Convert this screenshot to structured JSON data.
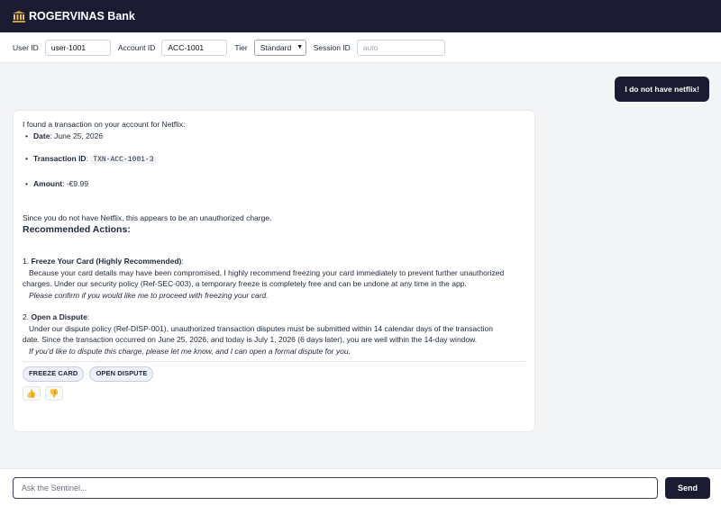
{
  "app": {
    "title": "ROGERVINAS Bank",
    "icon": "bank-icon"
  },
  "config": {
    "user_id_label": "User ID",
    "user_id_value": "user-1001",
    "account_id_label": "Account ID",
    "account_id_value": "ACC-1001",
    "tier_label": "Tier",
    "tier_value": "Standard",
    "session_id_label": "Session ID",
    "session_id_placeholder": "auto"
  },
  "chat": {
    "user_message": "I do not have netflix!",
    "bot": {
      "intro": "I found a transaction on your account for Netflix:",
      "date_label": "Date",
      "date_value": ": June 25, 2026",
      "txn_label": "Transaction ID",
      "txn_sep": ": ",
      "txn_value": "TXN-ACC-1001-3",
      "amount_label": "Amount",
      "amount_value": ": -€9.99",
      "unauthorized": "Since you do not have Netflix, this appears to be an unauthorized charge.",
      "heading": "Recommended Actions:",
      "freeze_num": "1. ",
      "freeze_title": "Freeze Your Card (Highly Recommended)",
      "freeze_colon": ":",
      "freeze_body_1": "Because your card details may have been compromised, I highly recommend freezing your card immediately to prevent further unauthorized",
      "freeze_body_2": "charges. Under our security policy (Ref-SEC-003), a temporary freeze is completely free and can be undone at any time in the app.",
      "freeze_confirm": "Please confirm if you would like me to proceed with freezing your card.",
      "dispute_num": "2. ",
      "dispute_title": "Open a Dispute",
      "dispute_colon": ":",
      "dispute_body_1": "Under our dispute policy (Ref-DISP-001), unauthorized transaction disputes must be submitted within 14 calendar days of the transaction",
      "dispute_body_2": "date. Since the transaction occurred on June 25, 2026, and today is July 1, 2026 (6 days later), you are well within the 14-day window.",
      "dispute_confirm": "If you'd like to dispute this charge, please let me know, and I can open a formal dispute for you."
    },
    "actions": {
      "freeze": "FREEZE CARD",
      "dispute": "OPEN DISPUTE"
    },
    "feedback": {
      "up_icon": "thumbs-up-icon",
      "down_icon": "thumbs-down-icon"
    }
  },
  "composer": {
    "placeholder": "Ask the Sentinel...",
    "send_label": "Send"
  }
}
